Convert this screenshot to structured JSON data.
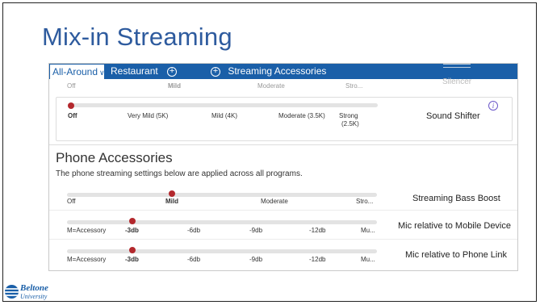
{
  "slide": {
    "title": "Mix-in Streaming"
  },
  "tabs": {
    "active": "All-Around",
    "chevron": "∨",
    "restaurant": "Restaurant",
    "plus": "+",
    "streaming_accessories": "Streaming Accessories"
  },
  "ghost_row": {
    "off": "Off",
    "mild": "Mild",
    "moderate": "Moderate",
    "strong": "Stro...",
    "silencer": "Silencer"
  },
  "sound_shifter": {
    "label": "Sound Shifter",
    "info": "i",
    "options": [
      "Off",
      "Very Mild (5K)",
      "Mild (4K)",
      "Moderate (3.5K)",
      "Strong",
      "(2.5K)"
    ],
    "selected": "Off",
    "selected_index": 0
  },
  "phone": {
    "title": "Phone Accessories",
    "description": "The phone streaming settings below are applied across all programs.",
    "bass_boost": {
      "label": "Streaming Bass Boost",
      "options": [
        "Off",
        "Mild",
        "Moderate",
        "Stro..."
      ],
      "selected": "Mild",
      "selected_index": 1
    },
    "mobile_mic": {
      "label": "Mic relative to Mobile Device",
      "options": [
        "M=Accessory",
        "-3db",
        "-6db",
        "-9db",
        "-12db",
        "Mu..."
      ],
      "selected": "-3db",
      "selected_index": 1
    },
    "phone_link_mic": {
      "label": "Mic relative to Phone Link",
      "options": [
        "M=Accessory",
        "-3db",
        "-6db",
        "-9db",
        "-12db",
        "Mu..."
      ],
      "selected": "-3db",
      "selected_index": 1
    }
  },
  "logo": {
    "brand": "Beltone",
    "sub": "University"
  },
  "colors": {
    "title": "#2e5b9e",
    "tabbar": "#1a5fa8",
    "slider_dot": "#b3282d",
    "track": "#e3e3e3"
  }
}
